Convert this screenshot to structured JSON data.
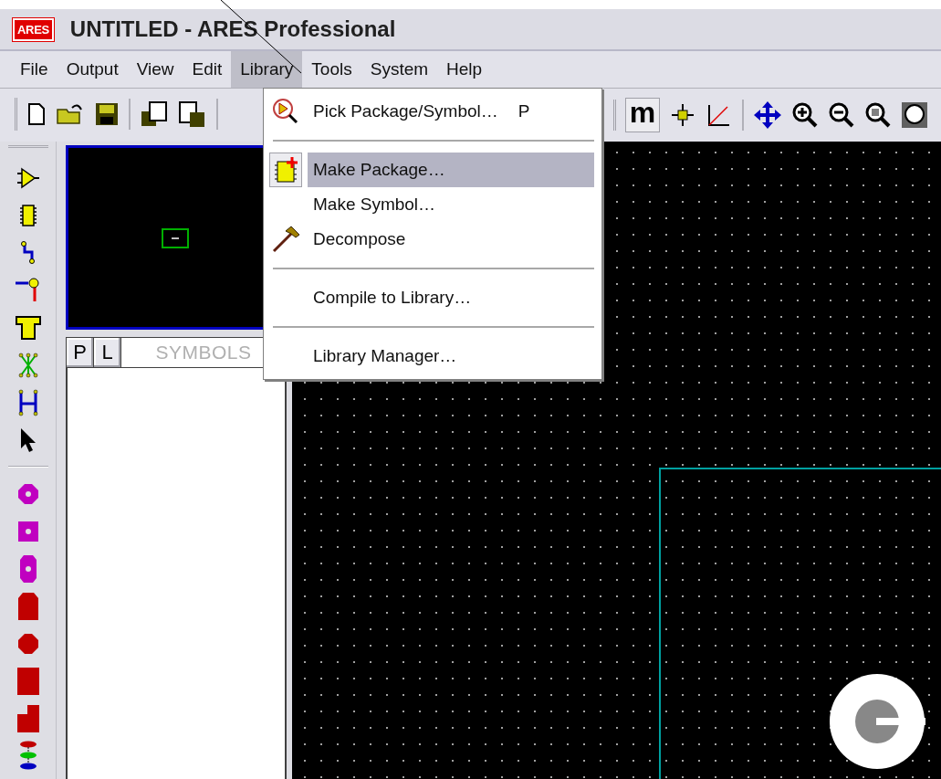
{
  "window": {
    "title": "UNTITLED - ARES Professional",
    "logo_text": "ARES"
  },
  "menu_bar": [
    {
      "label": "File",
      "selected": false
    },
    {
      "label": "Output",
      "selected": false
    },
    {
      "label": "View",
      "selected": false
    },
    {
      "label": "Edit",
      "selected": false
    },
    {
      "label": "Library",
      "selected": true
    },
    {
      "label": "Tools",
      "selected": false
    },
    {
      "label": "System",
      "selected": false
    },
    {
      "label": "Help",
      "selected": false
    }
  ],
  "library_menu": [
    {
      "kind": "item",
      "label": "Pick Package/Symbol…",
      "shortcut": "P",
      "selected": false
    },
    {
      "kind": "separator"
    },
    {
      "kind": "item",
      "label": "Make Package…",
      "selected": true
    },
    {
      "kind": "item",
      "label": "Make Symbol…",
      "selected": false
    },
    {
      "kind": "item",
      "label": "Decompose",
      "selected": false
    },
    {
      "kind": "separator"
    },
    {
      "kind": "item",
      "label": "Compile to Library…",
      "selected": false
    },
    {
      "kind": "separator"
    },
    {
      "kind": "item",
      "label": "Library Manager…",
      "selected": false
    }
  ],
  "toolbar": {
    "metric_button": {
      "label": "m",
      "pressed": true
    }
  },
  "selector": {
    "tabs": [
      {
        "label": "P",
        "selected": false
      },
      {
        "label": "L",
        "selected": false
      }
    ],
    "mode_label": "SYMBOLS"
  }
}
